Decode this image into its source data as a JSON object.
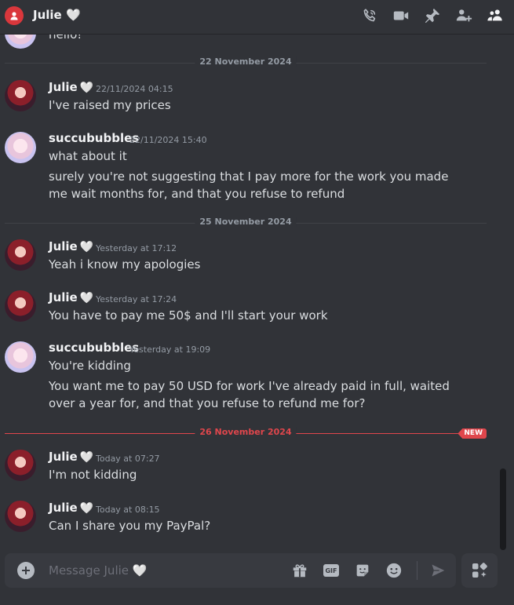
{
  "header": {
    "title": "Julie 🤍",
    "icons": [
      "start-voice-call-icon",
      "start-video-call-icon",
      "pinned-messages-icon",
      "add-friends-to-dm-icon",
      "user-profile-icon"
    ]
  },
  "partial_message": {
    "text": "hello!"
  },
  "dividers": {
    "d1": "22 November 2024",
    "d2": "25 November 2024",
    "d3": "26 November 2024",
    "new_label": "NEW"
  },
  "messages": [
    {
      "author": "Julie",
      "heart": "🤍",
      "time": "22/11/2024 04:15",
      "lines": [
        "I've raised my prices"
      ]
    },
    {
      "author": "succububbles",
      "heart": "",
      "time": "22/11/2024 15:40",
      "lines": [
        "what about it",
        "surely you're not suggesting that I pay more for the work you made me wait months for, and that you refuse to refund"
      ]
    },
    {
      "author": "Julie",
      "heart": "🤍",
      "time": "Yesterday at 17:12",
      "lines": [
        "Yeah i know my apologies"
      ]
    },
    {
      "author": "Julie",
      "heart": "🤍",
      "time": "Yesterday at 17:24",
      "lines": [
        "You have to pay me 50$ and I'll start your work"
      ]
    },
    {
      "author": "succububbles",
      "heart": "",
      "time": "Yesterday at 19:09",
      "lines": [
        "You're kidding",
        "You want me to pay 50 USD for work I've already paid in full, waited over a year for, and that you refuse to refund me for?"
      ]
    },
    {
      "author": "Julie",
      "heart": "🤍",
      "time": "Today at 07:27",
      "lines": [
        "I'm not kidding"
      ]
    },
    {
      "author": "Julie",
      "heart": "🤍",
      "time": "Today at 08:15",
      "lines": [
        "Can I share you my PayPal?"
      ]
    }
  ],
  "composer": {
    "placeholder": "Message Julie 🤍",
    "gif_label": "GIF"
  },
  "colors": {
    "background": "#313338",
    "composer": "#383a40",
    "dm_badge": "#da373c",
    "new_divider": "#e0464c",
    "text": "#dbdee1",
    "muted": "#949ba4"
  }
}
